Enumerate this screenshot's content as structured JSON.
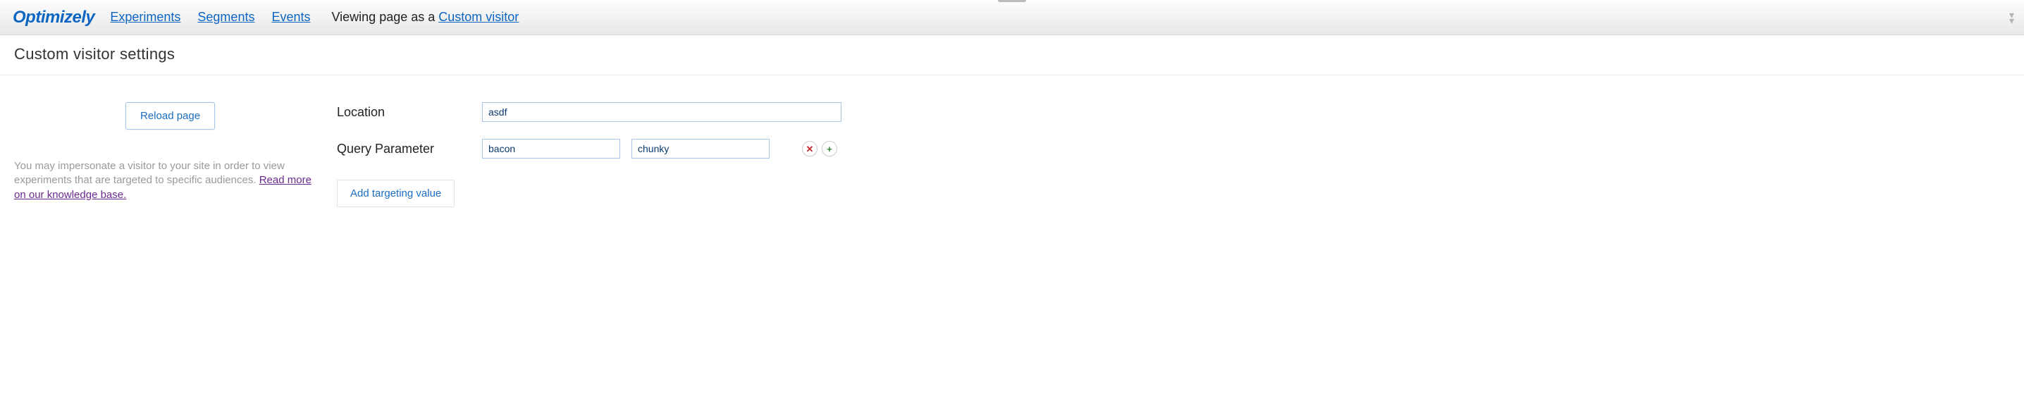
{
  "brand": "Optimizely",
  "nav": {
    "experiments": "Experiments",
    "segments": "Segments",
    "events": "Events"
  },
  "viewing": {
    "prefix": "Viewing page as a ",
    "link": "Custom visitor"
  },
  "pageTitle": "Custom visitor settings",
  "left": {
    "reload": "Reload page",
    "help1": "You may impersonate a visitor to your site in order to view experiments that are targeted to specific audiences.",
    "helpLink": "Read more on our knowledge base."
  },
  "form": {
    "locationLabel": "Location",
    "locationValue": "asdf",
    "queryLabel": "Query Parameter",
    "queryKey": "bacon",
    "queryValue": "chunky",
    "removeSymbol": "✕",
    "addSymbol": "+",
    "addTargeting": "Add targeting value"
  }
}
